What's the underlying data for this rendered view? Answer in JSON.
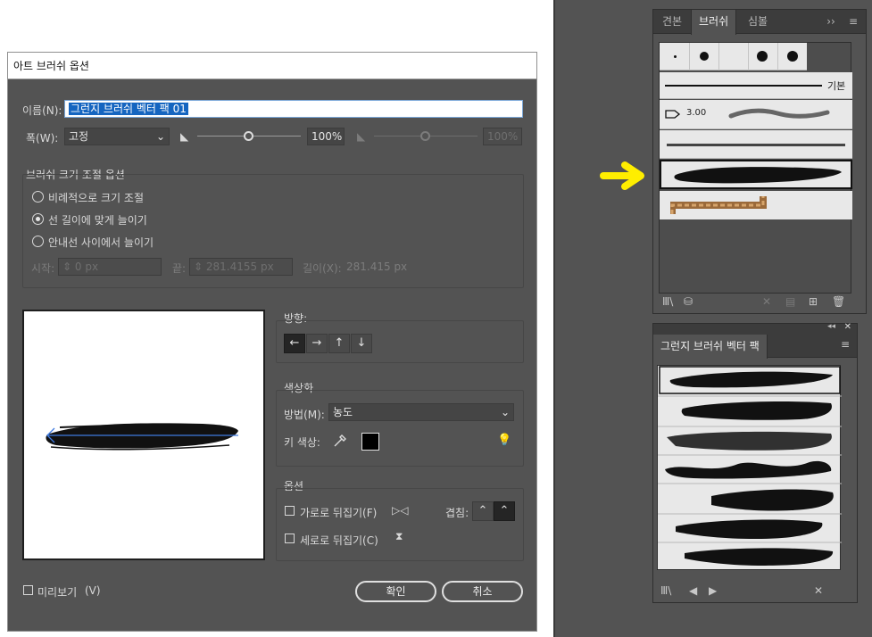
{
  "dialog": {
    "title": "아트 브러쉬 옵션",
    "name_label": "이름(N):",
    "name_value": "그런지 브러쉬 벡터 팩 01",
    "width_label": "폭(W):",
    "width_mode": "고정",
    "width_percent": "100%",
    "width_percent2": "100%",
    "scale_group_title": "브러쉬 크기 조절 옵션",
    "scale_options": [
      "비례적으로 크기 조절",
      "선 길이에 맞게 늘이기",
      "안내선 사이에서 늘이기"
    ],
    "selected_scale_option": 1,
    "start_label": "시작:",
    "start_value": "0 px",
    "end_label": "끝:",
    "end_value": "281.4155 px",
    "length_label": "길이(X):",
    "length_value": "281.415 px",
    "direction_label": "방향:",
    "direction_buttons": [
      "←",
      "→",
      "↑",
      "↓"
    ],
    "selected_direction": 0,
    "colorize_title": "색상화",
    "method_label": "방법(M):",
    "method_value": "농도",
    "key_color_label": "키 색상:",
    "key_color": "#000000",
    "options_title": "옵션",
    "flip_h_label": "가로로 뒤집기(F)",
    "flip_v_label": "세로로 뒤집기(C)",
    "overlap_label": "겹침:",
    "preview_label": "미리보기",
    "preview_shortcut": "(V)",
    "ok_label": "확인",
    "cancel_label": "취소"
  },
  "brushes_panel": {
    "tabs": [
      "견본",
      "브러쉬",
      "심볼"
    ],
    "active_tab": 1,
    "basic_label": "기본",
    "size_label": "3.00"
  },
  "library_panel": {
    "title": "그런지 브러쉬 벡터 팩"
  },
  "colors": {
    "accent_arrow": "#ffee00",
    "selection_blue": "#1565c0",
    "dialog_bg": "#535353"
  }
}
